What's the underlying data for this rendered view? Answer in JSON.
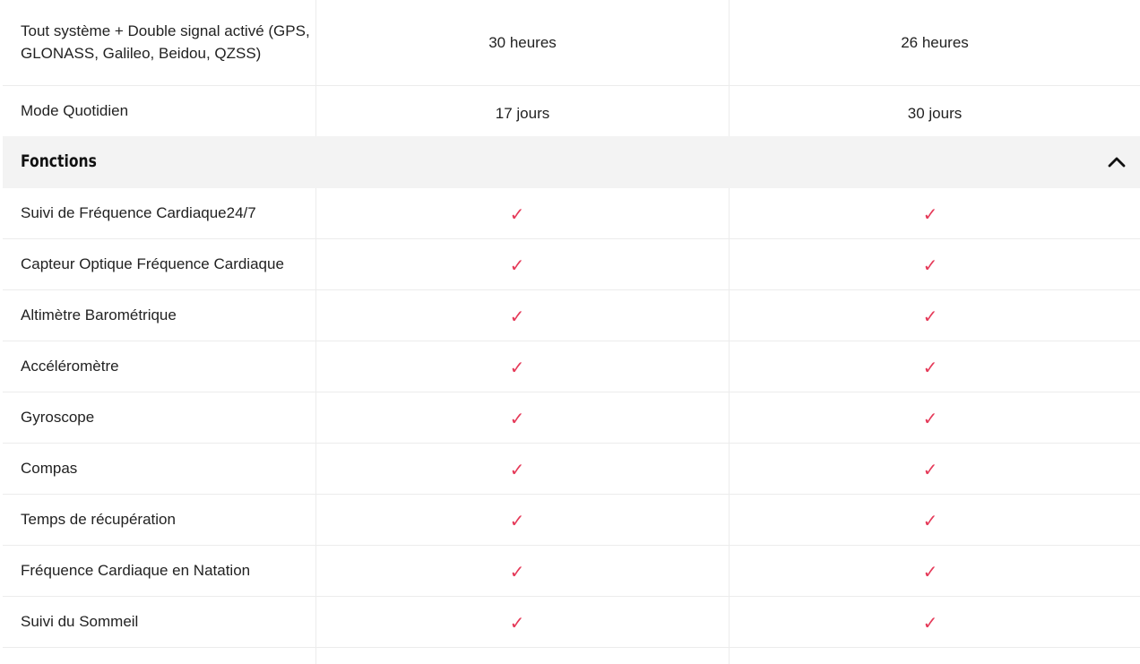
{
  "battery_rows": [
    {
      "label": "Tout système + Double signal activé (GPS, GLONASS, Galileo, Beidou, QZSS)",
      "col1": "30 heures",
      "col2": "26 heures"
    },
    {
      "label": "Mode Quotidien",
      "col1": "17 jours",
      "col2": "30 jours"
    }
  ],
  "section": {
    "title": "Fonctions",
    "toggle_icon": "chevron-up-icon"
  },
  "feature_rows": [
    {
      "label": "Suivi de Fréquence Cardiaque24/7",
      "col1": "✓",
      "col2": "✓"
    },
    {
      "label": "Capteur Optique Fréquence Cardiaque",
      "col1": "✓",
      "col2": "✓"
    },
    {
      "label": "Altimètre Barométrique",
      "col1": "✓",
      "col2": "✓"
    },
    {
      "label": "Accéléromètre",
      "col1": "✓",
      "col2": "✓"
    },
    {
      "label": "Gyroscope",
      "col1": "✓",
      "col2": "✓"
    },
    {
      "label": "Compas",
      "col1": "✓",
      "col2": "✓"
    },
    {
      "label": "Temps de récupération",
      "col1": "✓",
      "col2": "✓"
    },
    {
      "label": "Fréquence Cardiaque en Natation",
      "col1": "✓",
      "col2": "✓"
    },
    {
      "label": "Suivi du Sommeil",
      "col1": "✓",
      "col2": "✓"
    },
    {
      "label": "",
      "col1": "",
      "col2": ""
    }
  ],
  "colors": {
    "check": "#e53958",
    "section_bg": "#f3f3f3",
    "border": "#ececec"
  }
}
